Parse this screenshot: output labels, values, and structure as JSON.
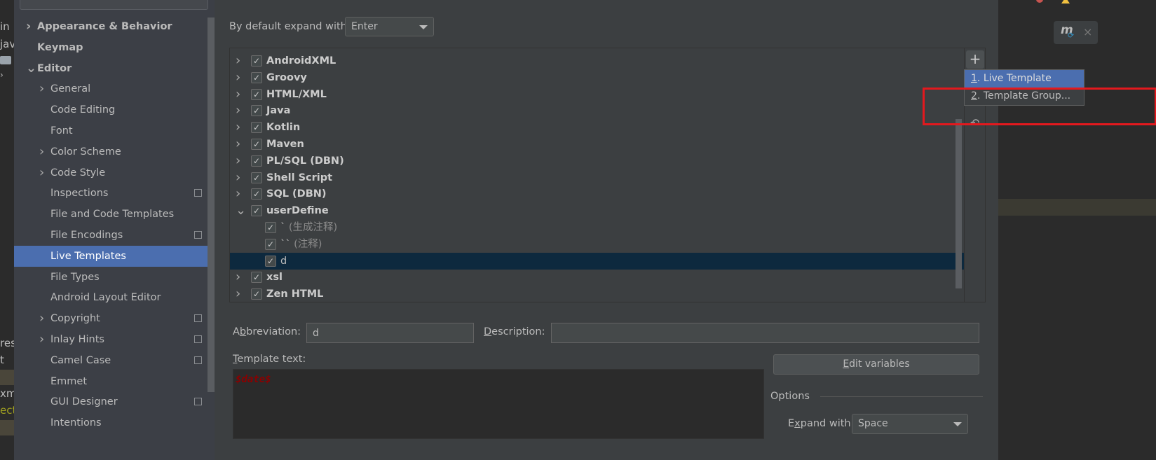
{
  "left_strip": {
    "fragments": [
      "in",
      "jav",
      "res",
      "t",
      "xml",
      "ect"
    ]
  },
  "sidebar": {
    "items": [
      {
        "label": "Appearance & Behavior",
        "level": 0,
        "bold": true,
        "chevron": "right"
      },
      {
        "label": "Keymap",
        "level": 0,
        "bold": true,
        "chevron": ""
      },
      {
        "label": "Editor",
        "level": 0,
        "bold": true,
        "chevron": "down"
      },
      {
        "label": "General",
        "level": 1,
        "chevron": "right"
      },
      {
        "label": "Code Editing",
        "level": 1
      },
      {
        "label": "Font",
        "level": 1
      },
      {
        "label": "Color Scheme",
        "level": 1,
        "chevron": "right"
      },
      {
        "label": "Code Style",
        "level": 1,
        "chevron": "right"
      },
      {
        "label": "Inspections",
        "level": 1,
        "project_icon": true
      },
      {
        "label": "File and Code Templates",
        "level": 1
      },
      {
        "label": "File Encodings",
        "level": 1,
        "project_icon": true
      },
      {
        "label": "Live Templates",
        "level": 1,
        "selected": true
      },
      {
        "label": "File Types",
        "level": 1
      },
      {
        "label": "Android Layout Editor",
        "level": 1
      },
      {
        "label": "Copyright",
        "level": 1,
        "chevron": "right",
        "project_icon": true
      },
      {
        "label": "Inlay Hints",
        "level": 1,
        "chevron": "right",
        "project_icon": true
      },
      {
        "label": "Camel Case",
        "level": 1,
        "project_icon": true
      },
      {
        "label": "Emmet",
        "level": 1
      },
      {
        "label": "GUI Designer",
        "level": 1,
        "project_icon": true
      },
      {
        "label": "Intentions",
        "level": 1
      }
    ]
  },
  "main": {
    "expand_label": "By default expand with",
    "expand_value": "Enter",
    "tree": [
      {
        "label": "AndroidXML",
        "type": "group",
        "expanded": false,
        "checked": true
      },
      {
        "label": "Groovy",
        "type": "group",
        "expanded": false,
        "checked": true
      },
      {
        "label": "HTML/XML",
        "type": "group",
        "expanded": false,
        "checked": true
      },
      {
        "label": "Java",
        "type": "group",
        "expanded": false,
        "checked": true
      },
      {
        "label": "Kotlin",
        "type": "group",
        "expanded": false,
        "checked": true
      },
      {
        "label": "Maven",
        "type": "group",
        "expanded": false,
        "checked": true
      },
      {
        "label": "PL/SQL (DBN)",
        "type": "group",
        "expanded": false,
        "checked": true
      },
      {
        "label": "Shell Script",
        "type": "group",
        "expanded": false,
        "checked": true
      },
      {
        "label": "SQL (DBN)",
        "type": "group",
        "expanded": false,
        "checked": true
      },
      {
        "label": "userDefine",
        "type": "group",
        "expanded": true,
        "checked": true
      },
      {
        "label": "`",
        "desc": "(生成注释)",
        "type": "item",
        "checked": true
      },
      {
        "label": "``",
        "desc": "(注释)",
        "type": "item",
        "checked": true
      },
      {
        "label": "d",
        "desc": "",
        "type": "item",
        "checked": true,
        "selected": true
      },
      {
        "label": "xsl",
        "type": "group",
        "expanded": false,
        "checked": true
      },
      {
        "label": "Zen HTML",
        "type": "group",
        "expanded": false,
        "checked": true
      }
    ],
    "toolbar": {
      "add": "+"
    },
    "popup": {
      "items": [
        {
          "num": "1",
          "label": ". Live Template"
        },
        {
          "num": "2",
          "label": ". Template Group..."
        }
      ]
    },
    "abbreviation_label": {
      "pre": "A",
      "u": "b",
      "post": "breviation:"
    },
    "abbreviation_value": "d",
    "description_label": {
      "pre": "",
      "u": "D",
      "post": "escription:"
    },
    "description_value": "",
    "template_text_label": {
      "pre": "",
      "u": "T",
      "post": "emplate text:"
    },
    "template_text": "$date$",
    "edit_variables": {
      "pre": "",
      "u": "E",
      "post": "dit variables"
    },
    "options_label": "Options",
    "expand_with_label": {
      "pre": "E",
      "u": "x",
      "post": "pand with"
    },
    "expand_with_value": "Space"
  },
  "colors": {
    "selection": "#4b6eaf",
    "tree_selection": "#0d293e",
    "highlight_box": "#e3191e",
    "template_var": "#8b0000"
  }
}
